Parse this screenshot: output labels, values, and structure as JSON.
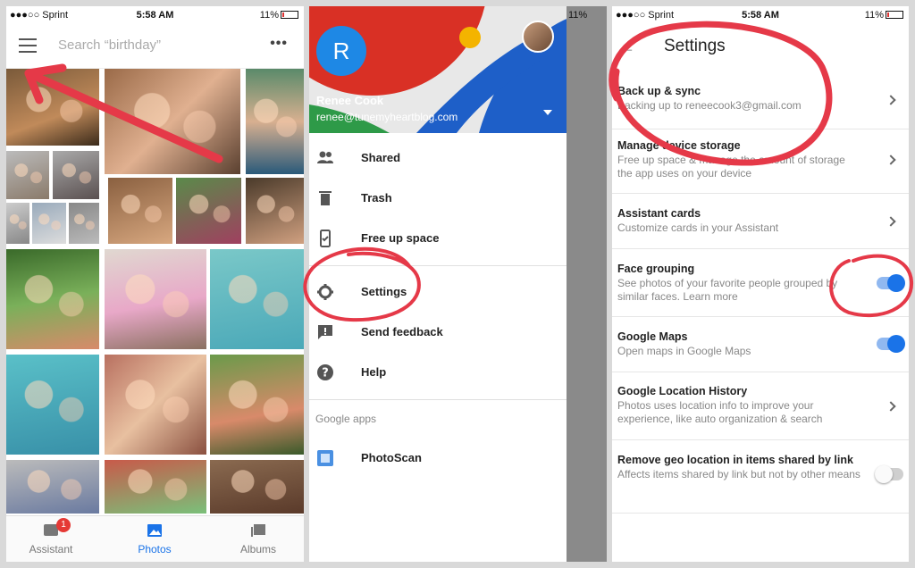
{
  "colors": {
    "accent": "#1a73e8",
    "annotation": "#e53948",
    "badge": "#e53935"
  },
  "status_bar": {
    "carrier": "●●●○○ Sprint",
    "time": "5:58 AM",
    "battery": "11%"
  },
  "photos_screen": {
    "search_placeholder": "Search “birthday”",
    "menu_icon": "hamburger-icon",
    "more_icon": "more-dots-icon",
    "more_label": "•••",
    "nav": [
      {
        "label": "Assistant",
        "icon": "assistant-icon",
        "badge": "1"
      },
      {
        "label": "Photos",
        "icon": "photos-icon",
        "active": true
      },
      {
        "label": "Albums",
        "icon": "albums-icon"
      }
    ]
  },
  "drawer": {
    "avatar_letter": "R",
    "name": "Renee Cook",
    "email": "renee@tunemyheartblog.com",
    "items": [
      {
        "label": "Shared",
        "icon": "people-icon"
      },
      {
        "label": "Trash",
        "icon": "trash-icon"
      },
      {
        "label": "Free up space",
        "icon": "phone-check-icon"
      },
      {
        "label": "Settings",
        "icon": "gear-icon"
      },
      {
        "label": "Send feedback",
        "icon": "feedback-icon"
      },
      {
        "label": "Help",
        "icon": "help-icon"
      }
    ],
    "section": "Google apps",
    "apps": [
      {
        "label": "PhotoScan",
        "icon": "photoscan-icon"
      }
    ]
  },
  "settings": {
    "title": "Settings",
    "items": [
      {
        "title": "Back up & sync",
        "desc": "Backing up to reneecook3@gmail.com",
        "control": "chevron"
      },
      {
        "title": "Manage device storage",
        "desc": "Free up space & manage the amount of storage the app uses on your device",
        "control": "chevron"
      },
      {
        "title": "Assistant cards",
        "desc": "Customize cards in your Assistant",
        "control": "chevron"
      },
      {
        "title": "Face grouping",
        "desc": "See photos of your favorite people grouped by similar faces. Learn more",
        "control": "toggle",
        "on": true
      },
      {
        "title": "Google Maps",
        "desc": "Open maps in Google Maps",
        "control": "toggle",
        "on": true
      },
      {
        "title": "Google Location History",
        "desc": "Photos uses location info to improve your experience, like auto organization & search",
        "control": "chevron"
      },
      {
        "title": "Remove geo location in items shared by link",
        "desc": "Affects items shared by link but not by other means",
        "control": "toggle",
        "on": false
      }
    ]
  }
}
